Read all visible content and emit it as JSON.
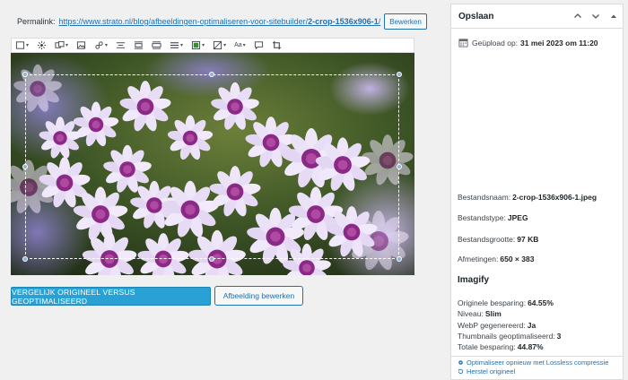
{
  "permalink": {
    "label": "Permalink:",
    "url_prefix": "https://www.strato.nl/blog/afbeeldingen-optimaliseren-voor-sitebuilder/",
    "url_slug": "2-crop-1536x906-1",
    "url_suffix": "/",
    "edit_label": "Bewerken"
  },
  "toolbar": {
    "items": [
      {
        "icon": "align-icon"
      },
      {
        "icon": "filter-icon"
      },
      {
        "icon": "duplicate-icon"
      },
      {
        "icon": "media-icon"
      },
      {
        "icon": "link-icon"
      },
      {
        "icon": "align-center-icon"
      },
      {
        "icon": "wide-width-icon"
      },
      {
        "icon": "full-width-icon"
      },
      {
        "icon": "align-justify-icon"
      },
      {
        "icon": "color-icon"
      },
      {
        "icon": "highlight-icon"
      },
      {
        "icon": "text-format-icon",
        "label": "Aa"
      },
      {
        "icon": "comment-icon"
      },
      {
        "icon": "crop-icon"
      }
    ]
  },
  "buttons": {
    "compare": "VERGELIJK ORIGINEEL VERSUS GEOPTIMALISEERD",
    "edit_image": "Afbeelding bewerken"
  },
  "panel": {
    "title": "Opslaan",
    "uploaded_label": "Geüpload op:",
    "uploaded_value": "31 mei 2023 om 11:20",
    "file_name_label": "Bestandsnaam:",
    "file_name": "2-crop-1536x906-1.jpeg",
    "file_type_label": "Bestandstype:",
    "file_type": "JPEG",
    "file_size_label": "Bestandsgrootte:",
    "file_size": "97 KB",
    "dimensions_label": "Afmetingen:",
    "dimensions": "650 × 383"
  },
  "imagify": {
    "title": "Imagify",
    "original_saving_label": "Originele besparing:",
    "original_saving": "64.55%",
    "level_label": "Niveau:",
    "level": "Slim",
    "webp_label": "WebP gegenereerd:",
    "webp": "Ja",
    "thumbs_label": "Thumbnails geoptimaliseerd:",
    "thumbs": "3",
    "total_label": "Totale besparing:",
    "total": "44.87%",
    "reoptimize_link": "Optimaliseer opnieuw met Lossless compressie",
    "restore_link": "Herstel origineel"
  },
  "colors": {
    "accent": "#2271b1",
    "compare_button": "#2aa1d4"
  }
}
